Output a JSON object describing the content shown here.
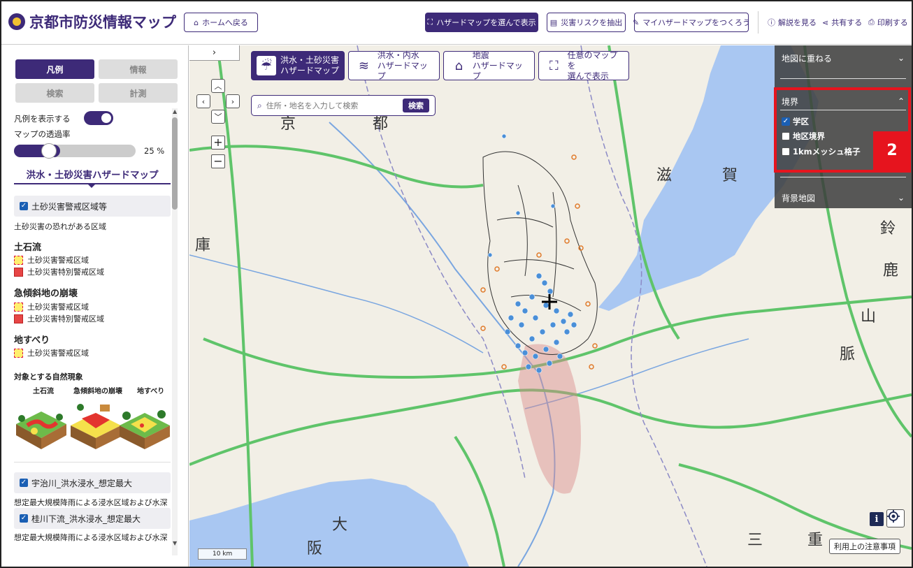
{
  "header": {
    "title": "京都市防災情報マップ",
    "home_label": "ホームへ戻る",
    "select_hazard_label": "ハザードマップを選んで表示",
    "extract_risk_label": "災害リスクを抽出",
    "my_hazard_label": "マイハザードマップをつくろう",
    "help_label": "解説を見る",
    "share_label": "共有する",
    "print_label": "印刷する"
  },
  "sidebar": {
    "tabs": [
      "凡例",
      "情報",
      "検索",
      "計測"
    ],
    "show_legend_label": "凡例を表示する",
    "opacity_label": "マップの透過率",
    "opacity_value": "25 %",
    "opacity_fraction": 0.25,
    "section_title": "洪水・土砂災害ハザードマップ",
    "layer1_label": "土砂災害警戒区域等",
    "layer1_desc": "土砂災害の恐れがある区域",
    "cat_debris": "土石流",
    "cat_slope": "急傾斜地の崩壊",
    "cat_landslide": "地すべり",
    "legend_warning": "土砂災害警戒区域",
    "legend_special": "土砂災害特別警戒区域",
    "phenomena_title": "対象とする自然現象",
    "ill_debris": "土石流",
    "ill_slope": "急傾斜地の崩壊",
    "ill_landslide": "地すべり",
    "layer2_label": "宇治川_洪水浸水_想定最大",
    "layer2_desc": "想定最大規模降雨による浸水区域および水深",
    "layer3_label": "桂川下流_洪水浸水_想定最大",
    "layer3_desc": "想定最大規模降雨による浸水区域および水深"
  },
  "map": {
    "hazard_buttons": [
      {
        "line1": "洪水・土砂災害",
        "line2": "ハザードマップ"
      },
      {
        "line1": "洪水・内水",
        "line2": "ハザードマップ"
      },
      {
        "line1": "地震",
        "line2": "ハザードマップ"
      },
      {
        "line1": "任意のマップを",
        "line2": "選んで表示"
      }
    ],
    "search_placeholder": "住所・地名を入力して検索",
    "search_button": "検索",
    "overlay_title": "地図に重ねる",
    "boundary_title": "境界",
    "boundary_items": [
      {
        "label": "学区",
        "checked": true
      },
      {
        "label": "地区境界",
        "checked": false
      },
      {
        "label": "1kmメッシュ格子",
        "checked": false
      }
    ],
    "basemap_title": "背景地図",
    "badge_number": "2",
    "notice_label": "利用上の注意事項",
    "scale_label": "10 km",
    "place_labels": [
      "滋",
      "賀",
      "庫",
      "大",
      "阪",
      "三",
      "重",
      "鈴",
      "鹿",
      "山",
      "脈",
      "京",
      "都"
    ]
  },
  "colors": {
    "brand": "#3d2a78",
    "highlight": "#e6141e",
    "water": "#a9c7f2",
    "expressway": "#5fc46a"
  }
}
